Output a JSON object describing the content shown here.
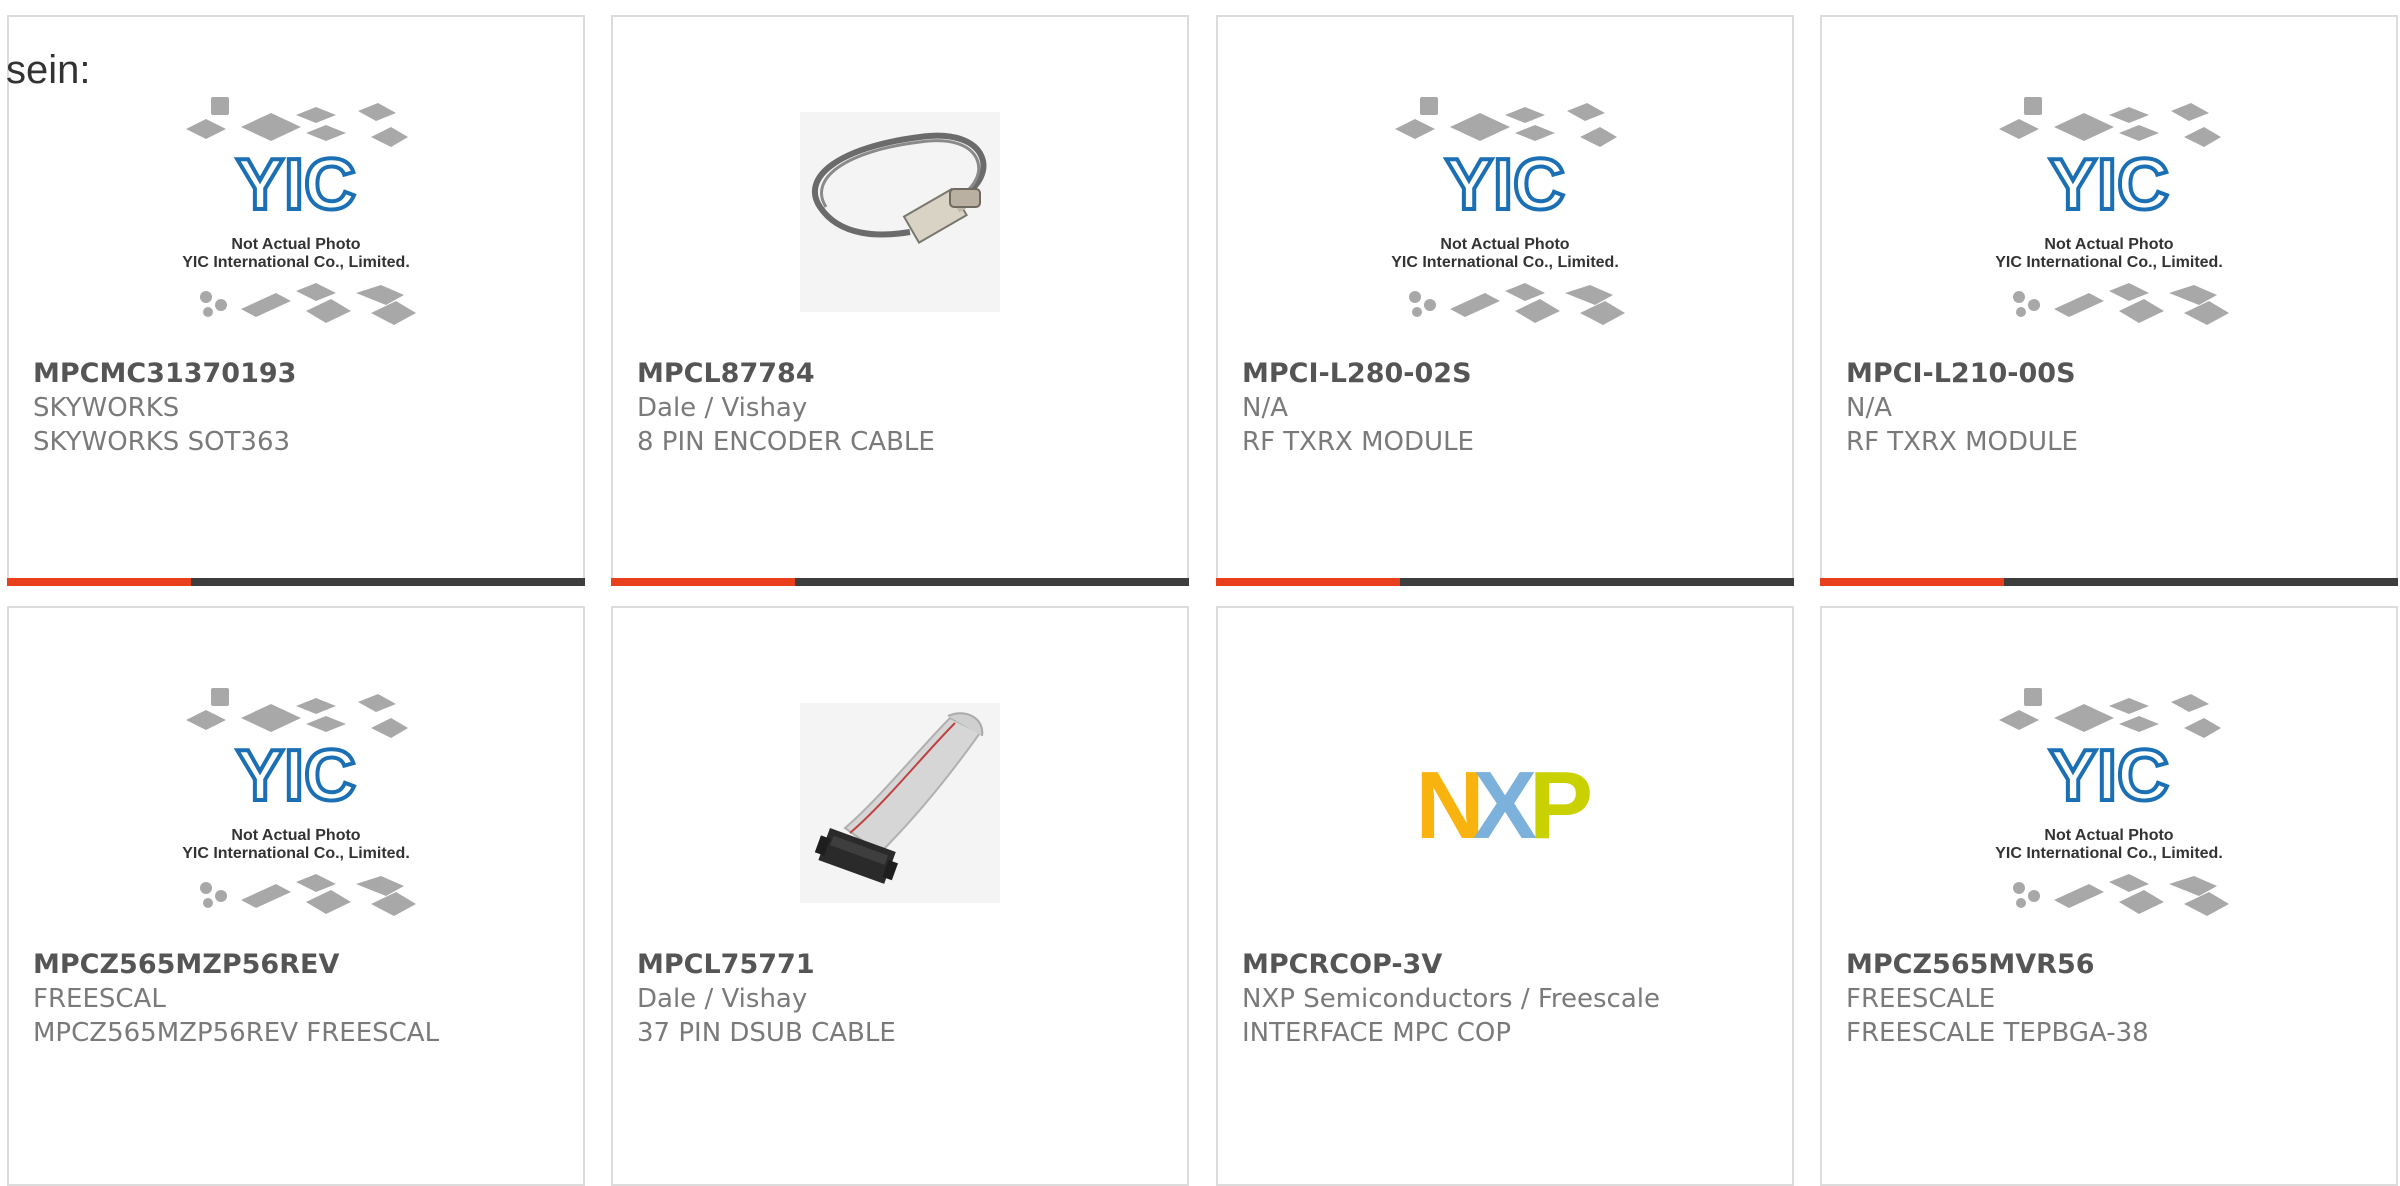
{
  "page_prefix": "sein:",
  "colors": {
    "accent": "#e8401c",
    "bar_dark": "#3d3d3d",
    "part_number": "#555555",
    "secondary_text": "#7a7a7a",
    "yic_blue": "#1a6fb5"
  },
  "placeholder_image": {
    "caption_line1": "Not Actual Photo",
    "caption_line2": "YIC International Co., Limited.",
    "logo_text": "YIC"
  },
  "products": [
    {
      "part_number": "MPCMC31370193",
      "manufacturer": "SKYWORKS",
      "description": "SKYWORKS SOT363",
      "image": "yic-placeholder-icon"
    },
    {
      "part_number": "MPCL87784",
      "manufacturer": "Dale / Vishay",
      "description": "8 PIN ENCODER CABLE",
      "image": "encoder-cable-icon"
    },
    {
      "part_number": "MPCI-L280-02S",
      "manufacturer": "N/A",
      "description": "RF TXRX MODULE",
      "image": "yic-placeholder-icon"
    },
    {
      "part_number": "MPCI-L210-00S",
      "manufacturer": "N/A",
      "description": "RF TXRX MODULE",
      "image": "yic-placeholder-icon"
    },
    {
      "part_number": "MPCZ565MZP56REV",
      "manufacturer": "FREESCAL",
      "description": "MPCZ565MZP56REV FREESCAL",
      "image": "yic-placeholder-icon"
    },
    {
      "part_number": "MPCL75771",
      "manufacturer": "Dale / Vishay",
      "description": "37 PIN DSUB CABLE",
      "image": "ribbon-cable-icon"
    },
    {
      "part_number": "MPCRCOP-3V",
      "manufacturer": "NXP Semiconductors / Freescale",
      "description": "INTERFACE MPC COP",
      "image": "nxp-logo-icon",
      "logo_letters": [
        "N",
        "X",
        "P"
      ]
    },
    {
      "part_number": "MPCZ565MVR56",
      "manufacturer": "FREESCALE",
      "description": "FREESCALE TEPBGA-38",
      "image": "yic-placeholder-icon"
    }
  ]
}
